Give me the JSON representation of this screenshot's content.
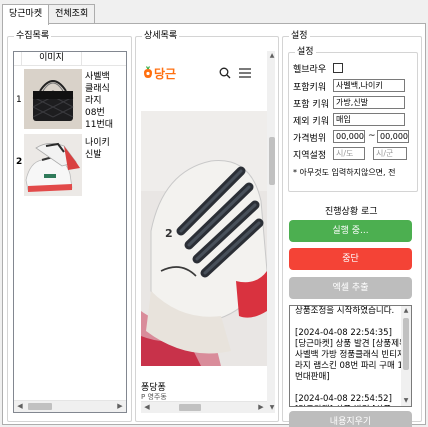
{
  "tabs": [
    {
      "label": "당근마켓",
      "active": true
    },
    {
      "label": "전체조회",
      "active": false
    }
  ],
  "collection": {
    "title": "수집목록",
    "header_image": "이미지",
    "rows": [
      {
        "num": "1",
        "lines": [
          "사벨백",
          "클래식",
          "라지",
          "08번",
          "11번대"
        ]
      },
      {
        "num": "2",
        "lines": [
          "나이키",
          "신발"
        ]
      }
    ]
  },
  "detail": {
    "title": "상세목록",
    "logo_text": "당근",
    "seller": "퐁당퐁",
    "location": "P 영주동",
    "icons": [
      "search-icon",
      "menu-icon"
    ]
  },
  "settings": {
    "title": "설정",
    "inner_title": "설정",
    "headless_label": "헬브라우",
    "include_label": "포함키워",
    "include_value": "사벨백,나이키",
    "category_label": "포함 키워",
    "category_value": "가방,신발",
    "exclude_label": "제외 키워",
    "exclude_value": "매입",
    "price_label": "가격범위",
    "price_min": "00,000",
    "price_tilde": "~",
    "price_max": "00,000",
    "region_label": "지역설정",
    "region_city_placeholder": "시/도",
    "region_district_placeholder": "시/군",
    "hint": "* 아무것도 입력하지않으면, 전",
    "progress_title": "진행상황 로그",
    "run_button": "실행 중...",
    "stop_button": "중단",
    "excel_button": "엑셀 추출",
    "clear_button": "내용지우기",
    "log_text": "상품조정을 시작하였습니다.\n\n[2024-04-08 22:54:35]\n[당근마켓] 상품 발견 [상품제목 : 사벨백 가방 정품클래식 빈티지 라지 램스킨 08번 파리 구매 11번대판매]\n\n[2024-04-08 22:54:52]\n[당근마켓] 상품 발견 [상품"
  },
  "colors": {
    "run": "#4caf50",
    "stop": "#f44336",
    "disabled": "#bdbdbd",
    "brand": "#ff6f0f"
  }
}
